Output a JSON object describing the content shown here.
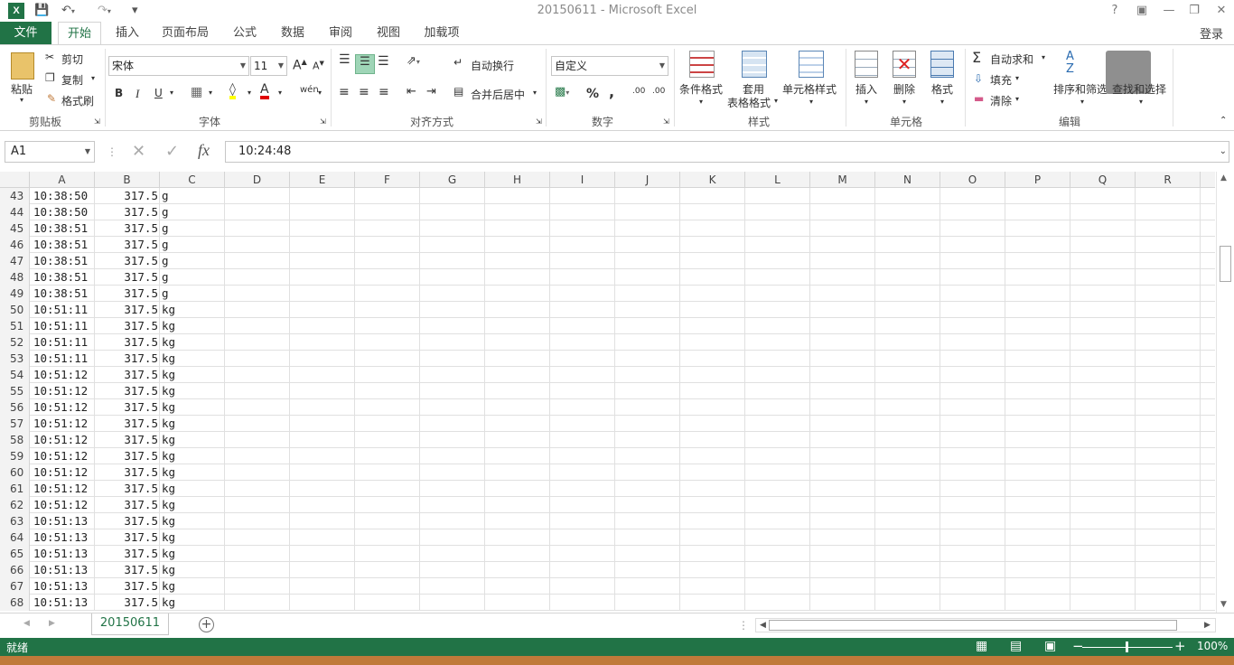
{
  "window": {
    "title": "20150611 - Microsoft Excel",
    "login": "登录"
  },
  "tabs": [
    "文件",
    "开始",
    "插入",
    "页面布局",
    "公式",
    "数据",
    "审阅",
    "视图",
    "加载项"
  ],
  "ribbon": {
    "clipboard": {
      "paste": "粘贴",
      "cut": "剪切",
      "copy": "复制",
      "format_painter": "格式刷",
      "label": "剪贴板"
    },
    "font": {
      "name": "宋体",
      "size": "11",
      "bold": "B",
      "italic": "I",
      "underline": "U",
      "grow": "A",
      "shrink": "A",
      "phonetic": "wén",
      "color": "A",
      "label": "字体"
    },
    "alignment": {
      "wrap": "自动换行",
      "merge": "合并后居中",
      "label": "对齐方式"
    },
    "number": {
      "format": "自定义",
      "percent": "%",
      "comma": ",",
      "inc": ".00",
      "dec": ".00",
      "label": "数字"
    },
    "styles": {
      "cond": "条件格式",
      "table1": "套用",
      "table2": "表格格式",
      "cell": "单元格样式",
      "label": "样式"
    },
    "cells": {
      "insert": "插入",
      "delete": "删除",
      "format": "格式",
      "label": "单元格"
    },
    "editing": {
      "autosum": "自动求和",
      "fill": "填充",
      "clear": "清除",
      "sort": "排序和筛选",
      "find": "查找和选择",
      "label": "编辑"
    }
  },
  "formula_bar": {
    "name_box": "A1",
    "fx": "fx",
    "value": "10:24:48"
  },
  "columns": [
    "A",
    "B",
    "C",
    "D",
    "E",
    "F",
    "G",
    "H",
    "I",
    "J",
    "K",
    "L",
    "M",
    "N",
    "O",
    "P",
    "Q",
    "R"
  ],
  "rows": [
    {
      "n": "43",
      "a": "10:38:50",
      "b": "317.5",
      "c": "g"
    },
    {
      "n": "44",
      "a": "10:38:50",
      "b": "317.5",
      "c": "g"
    },
    {
      "n": "45",
      "a": "10:38:51",
      "b": "317.5",
      "c": "g"
    },
    {
      "n": "46",
      "a": "10:38:51",
      "b": "317.5",
      "c": "g"
    },
    {
      "n": "47",
      "a": "10:38:51",
      "b": "317.5",
      "c": "g"
    },
    {
      "n": "48",
      "a": "10:38:51",
      "b": "317.5",
      "c": "g"
    },
    {
      "n": "49",
      "a": "10:38:51",
      "b": "317.5",
      "c": "g"
    },
    {
      "n": "50",
      "a": "10:51:11",
      "b": "317.5",
      "c": "kg"
    },
    {
      "n": "51",
      "a": "10:51:11",
      "b": "317.5",
      "c": "kg"
    },
    {
      "n": "52",
      "a": "10:51:11",
      "b": "317.5",
      "c": "kg"
    },
    {
      "n": "53",
      "a": "10:51:11",
      "b": "317.5",
      "c": "kg"
    },
    {
      "n": "54",
      "a": "10:51:12",
      "b": "317.5",
      "c": "kg"
    },
    {
      "n": "55",
      "a": "10:51:12",
      "b": "317.5",
      "c": "kg"
    },
    {
      "n": "56",
      "a": "10:51:12",
      "b": "317.5",
      "c": "kg"
    },
    {
      "n": "57",
      "a": "10:51:12",
      "b": "317.5",
      "c": "kg"
    },
    {
      "n": "58",
      "a": "10:51:12",
      "b": "317.5",
      "c": "kg"
    },
    {
      "n": "59",
      "a": "10:51:12",
      "b": "317.5",
      "c": "kg"
    },
    {
      "n": "60",
      "a": "10:51:12",
      "b": "317.5",
      "c": "kg"
    },
    {
      "n": "61",
      "a": "10:51:12",
      "b": "317.5",
      "c": "kg"
    },
    {
      "n": "62",
      "a": "10:51:12",
      "b": "317.5",
      "c": "kg"
    },
    {
      "n": "63",
      "a": "10:51:13",
      "b": "317.5",
      "c": "kg"
    },
    {
      "n": "64",
      "a": "10:51:13",
      "b": "317.5",
      "c": "kg"
    },
    {
      "n": "65",
      "a": "10:51:13",
      "b": "317.5",
      "c": "kg"
    },
    {
      "n": "66",
      "a": "10:51:13",
      "b": "317.5",
      "c": "kg"
    },
    {
      "n": "67",
      "a": "10:51:13",
      "b": "317.5",
      "c": "kg"
    },
    {
      "n": "68",
      "a": "10:51:13",
      "b": "317.5",
      "c": "kg"
    }
  ],
  "sheet_tab": "20150611",
  "status": {
    "ready": "就绪",
    "zoom": "100%"
  },
  "colors": {
    "accent": "#217346"
  }
}
